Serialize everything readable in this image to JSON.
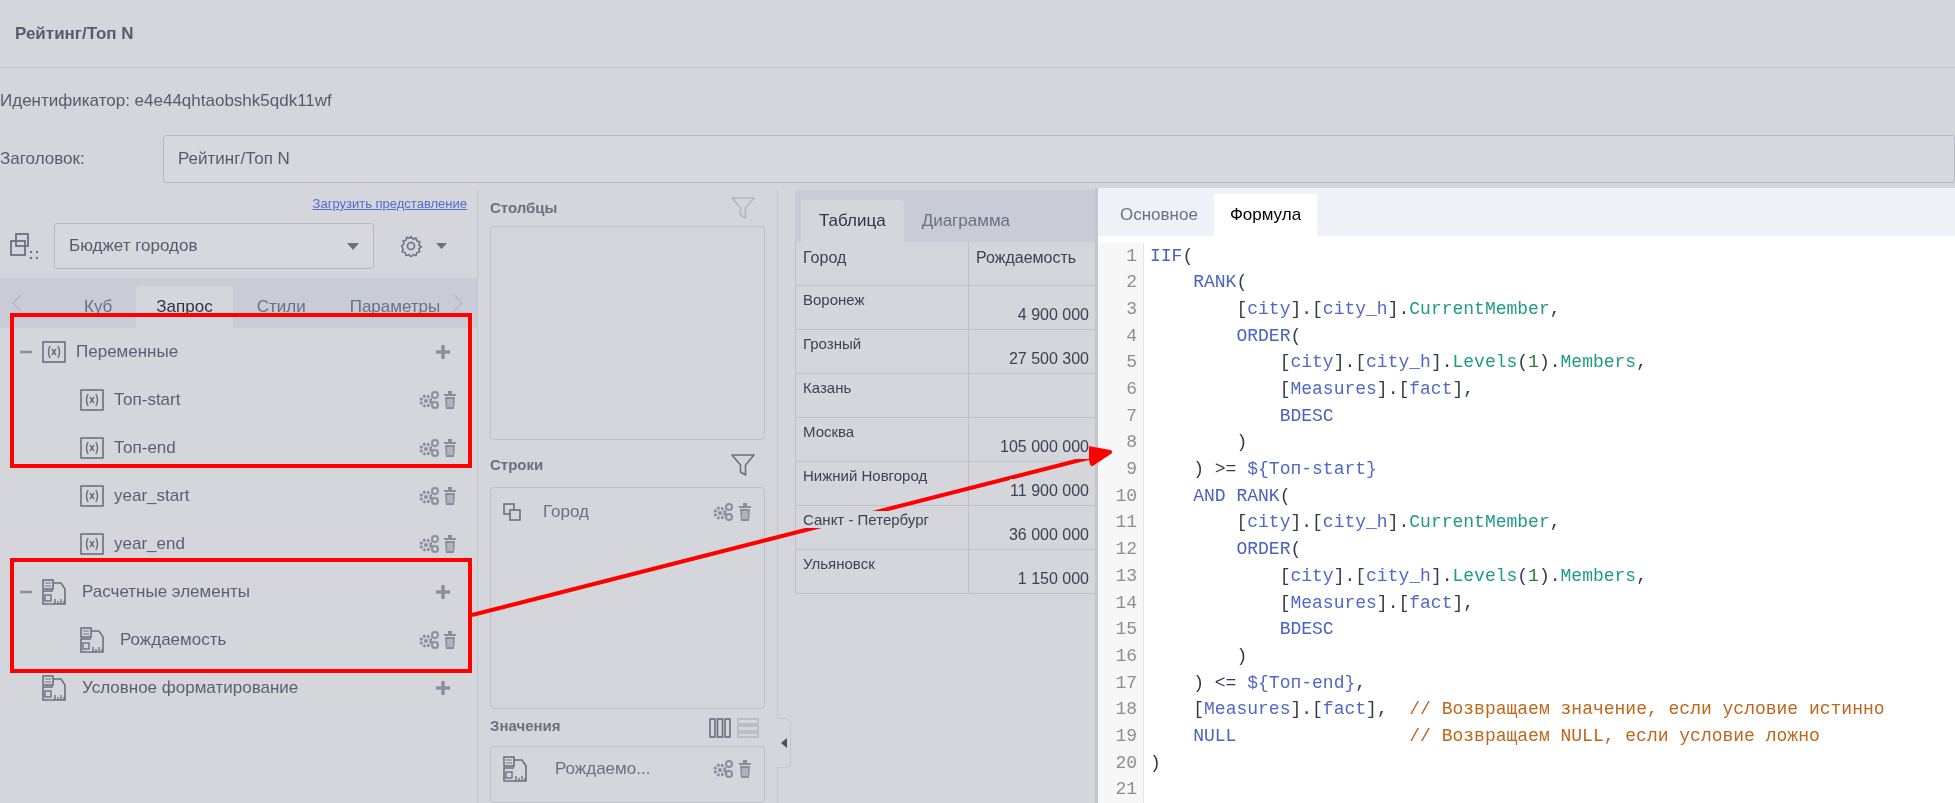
{
  "window": {
    "title": "Рейтинг/Топ N"
  },
  "identifier": "Идентификатор: e4e44qhtaobshk5qdk11wf",
  "heading_field": {
    "label": "Заголовок:",
    "value": "Рейтинг/Топ N"
  },
  "load_view_link": "Загрузить представление",
  "cube_select": {
    "value": "Бюджет городов"
  },
  "left_tabs": [
    {
      "label": "Куб",
      "selected": false
    },
    {
      "label": "Запрос",
      "selected": true
    },
    {
      "label": "Стили",
      "selected": false
    },
    {
      "label": "Параметры",
      "selected": false
    }
  ],
  "tree": [
    {
      "label": "Переменные",
      "kind": "variable",
      "expanded": true,
      "children": [
        {
          "label": "Топ-start",
          "kind": "variable"
        },
        {
          "label": "Топ-end",
          "kind": "variable"
        },
        {
          "label": "year_start",
          "kind": "variable"
        },
        {
          "label": "year_end",
          "kind": "variable"
        }
      ]
    },
    {
      "label": "Расчетные элементы",
      "kind": "calc",
      "expanded": true,
      "children": [
        {
          "label": "Рождаемость",
          "kind": "calc"
        }
      ]
    },
    {
      "label": "Условное форматирование",
      "kind": "calc"
    }
  ],
  "columns_section": {
    "title": "Столбцы"
  },
  "rows_section": {
    "title": "Строки",
    "items": [
      {
        "label": "Город"
      }
    ]
  },
  "values_section": {
    "title": "Значения",
    "items": [
      {
        "label": "Рождаемо..."
      }
    ]
  },
  "view_tabs": [
    {
      "label": "Таблица",
      "selected": true
    },
    {
      "label": "Диаграмма",
      "selected": false
    }
  ],
  "table": {
    "columns": [
      "Город",
      "Рождаемость"
    ],
    "rows": [
      {
        "city": "Воронеж",
        "value": "4 900 000"
      },
      {
        "city": "Грозный",
        "value": "27 500 300"
      },
      {
        "city": "Казань"
      },
      {
        "city": "Москва",
        "value": "105 000 000"
      },
      {
        "city": "Нижний Новгород",
        "value": "11 900 000"
      },
      {
        "city": "Санкт - Петербург",
        "value": "36 000 000"
      },
      {
        "city": "Ульяновск",
        "value": "1 150 000"
      }
    ]
  },
  "editor_tabs": [
    {
      "label": "Основное",
      "selected": false
    },
    {
      "label": "Формула",
      "selected": true
    }
  ],
  "code_lines": [
    {
      "number": "1",
      "tokens": [
        {
          "kind": "keyword",
          "text": "IIF"
        },
        {
          "kind": "punct",
          "text": "("
        }
      ]
    },
    {
      "number": "2",
      "tokens": [
        {
          "kind": "keyword",
          "text": "    RANK"
        },
        {
          "kind": "punct",
          "text": "("
        }
      ]
    },
    {
      "number": "3",
      "tokens": [
        {
          "kind": "punct",
          "text": "        ["
        },
        {
          "kind": "name",
          "text": "city"
        },
        {
          "kind": "punct",
          "text": "].["
        },
        {
          "kind": "name",
          "text": "city_h"
        },
        {
          "kind": "punct",
          "text": "]."
        },
        {
          "kind": "function",
          "text": "CurrentMember"
        },
        {
          "kind": "punct",
          "text": ","
        }
      ]
    },
    {
      "number": "4",
      "tokens": [
        {
          "kind": "keyword",
          "text": "        ORDER"
        },
        {
          "kind": "punct",
          "text": "("
        }
      ]
    },
    {
      "number": "5",
      "tokens": [
        {
          "kind": "punct",
          "text": "            ["
        },
        {
          "kind": "name",
          "text": "city"
        },
        {
          "kind": "punct",
          "text": "].["
        },
        {
          "kind": "name",
          "text": "city_h"
        },
        {
          "kind": "punct",
          "text": "]."
        },
        {
          "kind": "function",
          "text": "Levels"
        },
        {
          "kind": "punct",
          "text": "("
        },
        {
          "kind": "number",
          "text": "1"
        },
        {
          "kind": "punct",
          "text": ")."
        },
        {
          "kind": "function",
          "text": "Members"
        },
        {
          "kind": "punct",
          "text": ","
        }
      ]
    },
    {
      "number": "6",
      "tokens": [
        {
          "kind": "punct",
          "text": "            ["
        },
        {
          "kind": "name",
          "text": "Measures"
        },
        {
          "kind": "punct",
          "text": "].["
        },
        {
          "kind": "name",
          "text": "fact"
        },
        {
          "kind": "punct",
          "text": "],"
        }
      ]
    },
    {
      "number": "7",
      "tokens": [
        {
          "kind": "keyword",
          "text": "            BDESC"
        }
      ]
    },
    {
      "number": "8",
      "tokens": [
        {
          "kind": "punct",
          "text": "        )"
        }
      ]
    },
    {
      "number": "9",
      "tokens": [
        {
          "kind": "punct",
          "text": "    ) >= "
        },
        {
          "kind": "name",
          "text": "${Топ-start}"
        }
      ]
    },
    {
      "number": "10",
      "tokens": [
        {
          "kind": "keyword",
          "text": "    AND"
        },
        {
          "kind": "keyword",
          "text": " RANK"
        },
        {
          "kind": "punct",
          "text": "("
        }
      ]
    },
    {
      "number": "11",
      "tokens": [
        {
          "kind": "punct",
          "text": "        ["
        },
        {
          "kind": "name",
          "text": "city"
        },
        {
          "kind": "punct",
          "text": "].["
        },
        {
          "kind": "name",
          "text": "city_h"
        },
        {
          "kind": "punct",
          "text": "]."
        },
        {
          "kind": "function",
          "text": "CurrentMember"
        },
        {
          "kind": "punct",
          "text": ","
        }
      ]
    },
    {
      "number": "12",
      "tokens": [
        {
          "kind": "keyword",
          "text": "        ORDER"
        },
        {
          "kind": "punct",
          "text": "("
        }
      ]
    },
    {
      "number": "13",
      "tokens": [
        {
          "kind": "punct",
          "text": "            ["
        },
        {
          "kind": "name",
          "text": "city"
        },
        {
          "kind": "punct",
          "text": "].["
        },
        {
          "kind": "name",
          "text": "city_h"
        },
        {
          "kind": "punct",
          "text": "]."
        },
        {
          "kind": "function",
          "text": "Levels"
        },
        {
          "kind": "punct",
          "text": "("
        },
        {
          "kind": "number",
          "text": "1"
        },
        {
          "kind": "punct",
          "text": ")."
        },
        {
          "kind": "function",
          "text": "Members"
        },
        {
          "kind": "punct",
          "text": ","
        }
      ]
    },
    {
      "number": "14",
      "tokens": [
        {
          "kind": "punct",
          "text": "            ["
        },
        {
          "kind": "name",
          "text": "Measures"
        },
        {
          "kind": "punct",
          "text": "].["
        },
        {
          "kind": "name",
          "text": "fact"
        },
        {
          "kind": "punct",
          "text": "],"
        }
      ]
    },
    {
      "number": "15",
      "tokens": [
        {
          "kind": "keyword",
          "text": "            BDESC"
        }
      ]
    },
    {
      "number": "16",
      "tokens": [
        {
          "kind": "punct",
          "text": "        )"
        }
      ]
    },
    {
      "number": "17",
      "tokens": [
        {
          "kind": "punct",
          "text": "    ) <= "
        },
        {
          "kind": "name",
          "text": "${Топ-end}"
        },
        {
          "kind": "punct",
          "text": ","
        }
      ]
    },
    {
      "number": "18",
      "tokens": [
        {
          "kind": "punct",
          "text": "    ["
        },
        {
          "kind": "name",
          "text": "Measures"
        },
        {
          "kind": "punct",
          "text": "].["
        },
        {
          "kind": "name",
          "text": "fact"
        },
        {
          "kind": "punct",
          "text": "],"
        },
        {
          "kind": "comment",
          "text": "  // Возвращаем значение, если условие истинно"
        }
      ]
    },
    {
      "number": "19",
      "tokens": [
        {
          "kind": "keyword",
          "text": "    NULL"
        },
        {
          "kind": "comment",
          "text": "                // Возвращаем NULL, если условие ложно"
        }
      ]
    },
    {
      "number": "20",
      "tokens": [
        {
          "kind": "punct",
          "text": ")"
        }
      ]
    },
    {
      "number": "21"
    }
  ]
}
